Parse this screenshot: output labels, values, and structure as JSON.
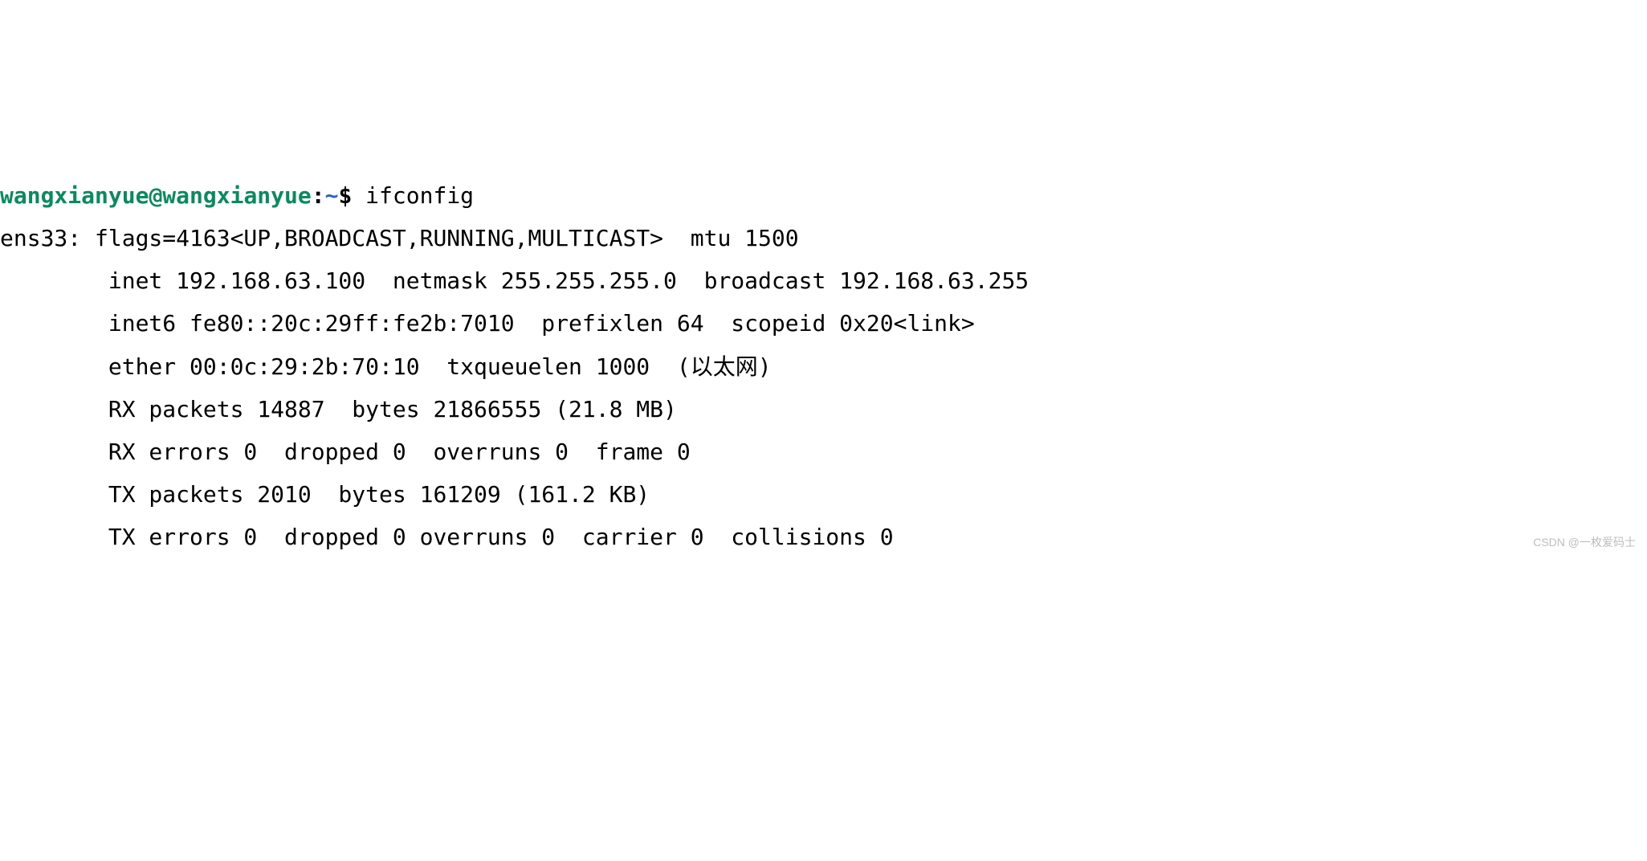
{
  "prompt": {
    "user": "wangxianyue",
    "at": "@",
    "host": "wangxianyue",
    "colon": ":",
    "path": "~",
    "dollar": "$"
  },
  "command": "ifconfig",
  "output": {
    "line1": "ens33: flags=4163<UP,BROADCAST,RUNNING,MULTICAST>  mtu 1500",
    "line2": "        inet 192.168.63.100  netmask 255.255.255.0  broadcast 192.168.63.255",
    "line3": "        inet6 fe80::20c:29ff:fe2b:7010  prefixlen 64  scopeid 0x20<link>",
    "line4": "        ether 00:0c:29:2b:70:10  txqueuelen 1000  (以太网)",
    "line5": "        RX packets 14887  bytes 21866555 (21.8 MB)",
    "line6": "        RX errors 0  dropped 0  overruns 0  frame 0",
    "line7": "        TX packets 2010  bytes 161209 (161.2 KB)",
    "line8": "        TX errors 0  dropped 0 overruns 0  carrier 0  collisions 0"
  },
  "watermark": "CSDN @一枚爱码士"
}
